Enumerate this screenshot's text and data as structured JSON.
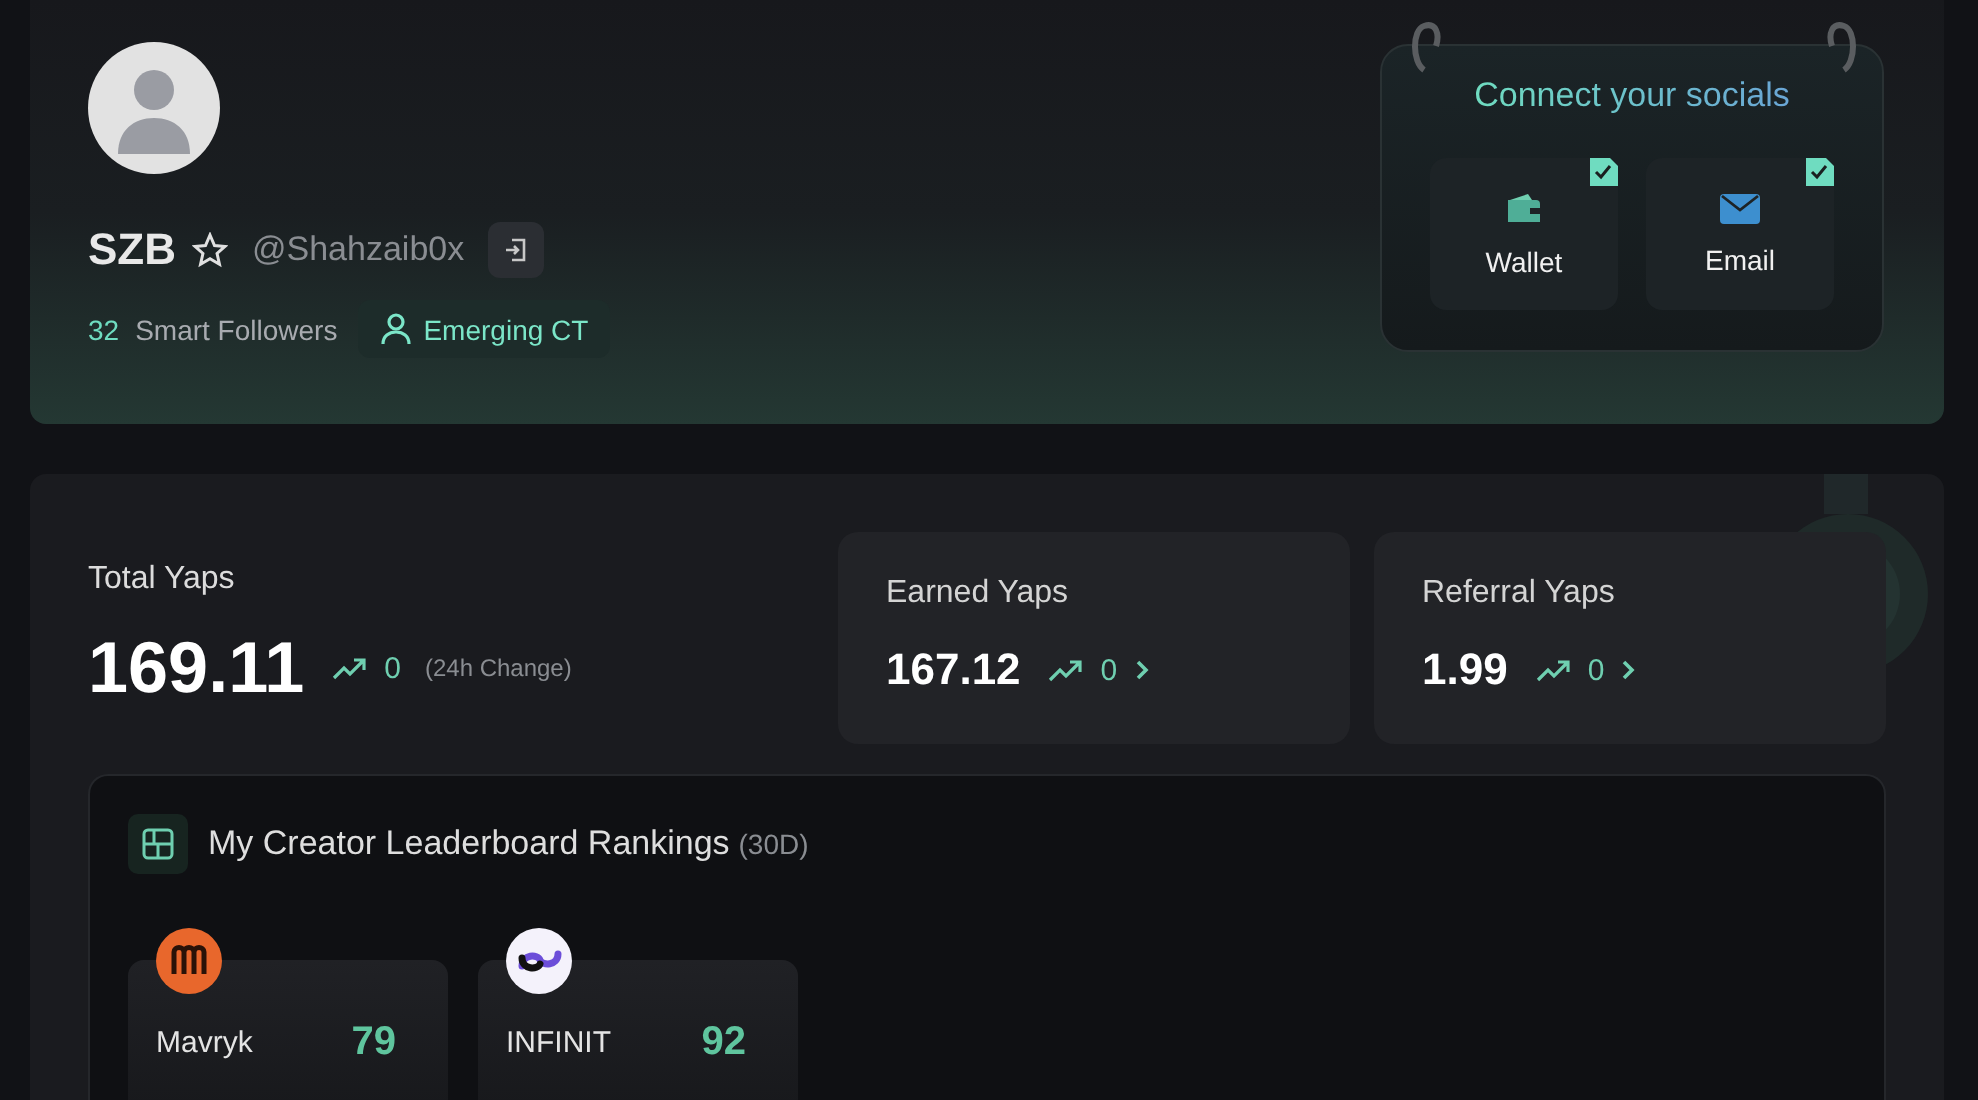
{
  "profile": {
    "name": "SZB",
    "handle": "@Shahzaib0x",
    "smart_followers_count": "32",
    "smart_followers_label": "Smart Followers",
    "badge": "Emerging CT"
  },
  "socials": {
    "title": "Connect your socials",
    "items": [
      {
        "kind": "wallet",
        "label": "Wallet",
        "connected": true
      },
      {
        "kind": "email",
        "label": "Email",
        "connected": true
      }
    ]
  },
  "total": {
    "label": "Total Yaps",
    "value": "169.11",
    "change": "0",
    "change_note": "(24h Change)"
  },
  "stats": [
    {
      "label": "Earned Yaps",
      "value": "167.12",
      "change": "0"
    },
    {
      "label": "Referral Yaps",
      "value": "1.99",
      "change": "0"
    }
  ],
  "leaderboard": {
    "title": "My Creator Leaderboard Rankings",
    "period": "(30D)",
    "items": [
      {
        "kind": "mavryk",
        "name": "Mavryk",
        "rank": "79"
      },
      {
        "kind": "infinit",
        "name": "INFINIT",
        "rank": "92"
      }
    ]
  }
}
